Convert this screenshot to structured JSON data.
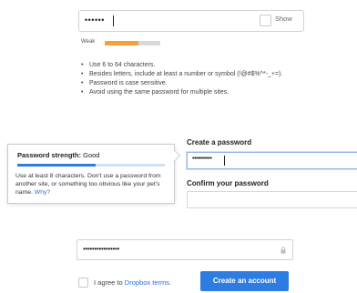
{
  "panel1": {
    "password_mask": "••••••",
    "show_label": "Show",
    "strength_label": "Weak",
    "strength_level": 0.6,
    "rules": [
      "Use 6 to 64 characters.",
      "Besides letters, include at least a number or symbol (!@#$%^*-_+=).",
      "Password is case sensitive.",
      "Avoid using the same password for multiple sites."
    ]
  },
  "panel2": {
    "strength_prefix": "Password strength:",
    "strength_value": "Good",
    "strength_level": 0.53,
    "advice": "Use at least 8 characters. Don't use a password from another site, or something too obvious like your pet's name.",
    "why_link": "Why?",
    "create_label": "Create a password",
    "create_mask": "•••••••••••",
    "confirm_label": "Confirm your password"
  },
  "panel3": {
    "password_mask": "••••••••••••••••",
    "agree_prefix": "I agree to",
    "terms_link": "Dropbox terms.",
    "create_button": "Create an account"
  },
  "colors": {
    "accent": "#2d7ce2",
    "weak": "#f5a13b",
    "link": "#2b6fd6"
  }
}
